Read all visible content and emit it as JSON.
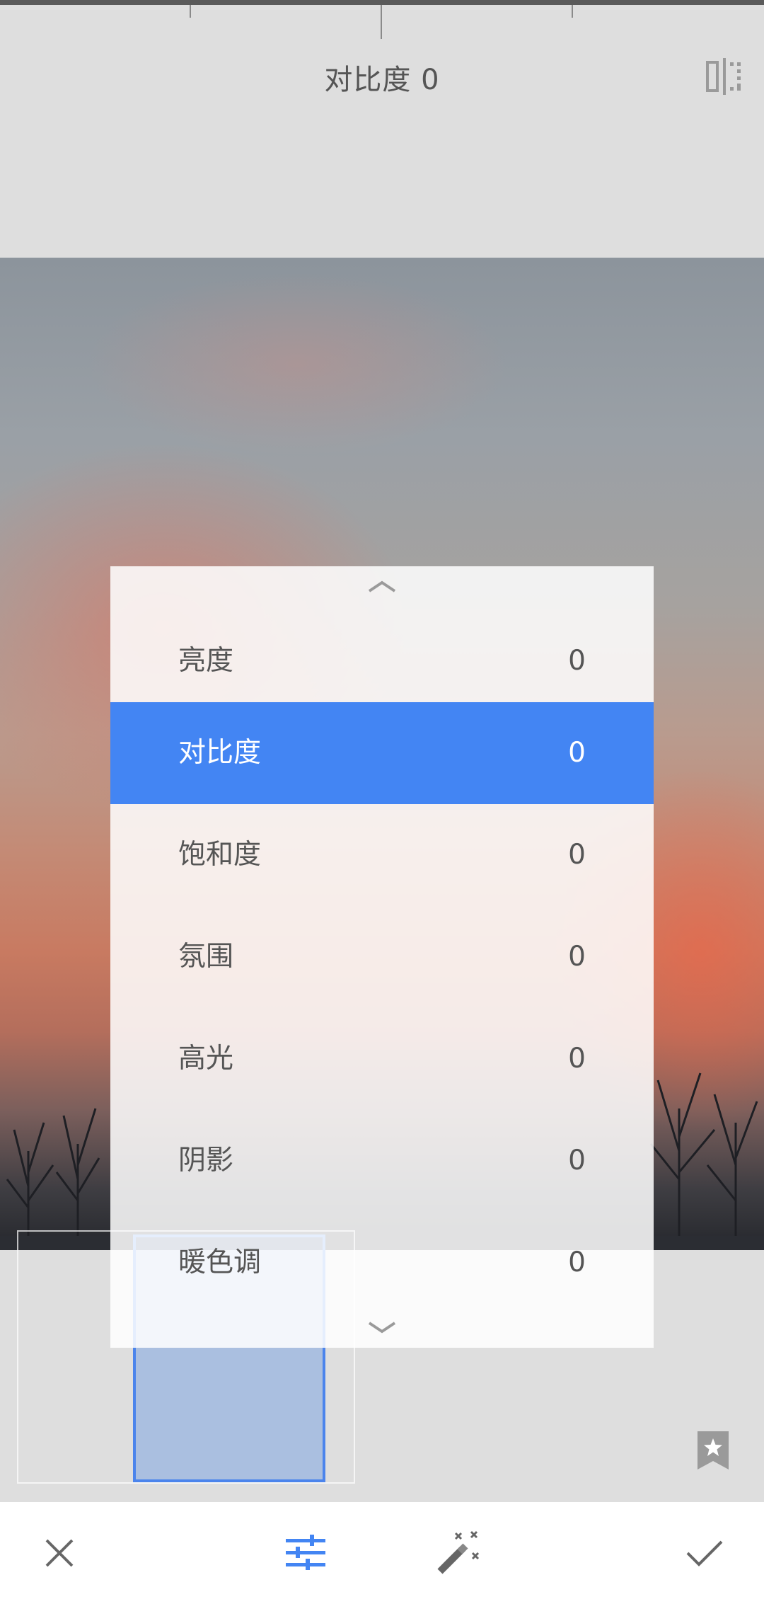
{
  "header": {
    "title": "对比度 0"
  },
  "panel": {
    "items": [
      {
        "label": "亮度",
        "value": "0",
        "active": false
      },
      {
        "label": "对比度",
        "value": "0",
        "active": true
      },
      {
        "label": "饱和度",
        "value": "0",
        "active": false
      },
      {
        "label": "氛围",
        "value": "0",
        "active": false
      },
      {
        "label": "高光",
        "value": "0",
        "active": false
      },
      {
        "label": "阴影",
        "value": "0",
        "active": false
      },
      {
        "label": "暖色调",
        "value": "0",
        "active": false
      }
    ]
  },
  "icons": {
    "compare": "compare-icon",
    "scroll_up": "chevron-up-icon",
    "scroll_down": "chevron-down-icon",
    "bookmark": "star-bookmark-icon",
    "cancel": "close-icon",
    "adjust": "sliders-icon",
    "auto": "magic-wand-icon",
    "apply": "checkmark-icon"
  },
  "colors": {
    "accent": "#4385f3",
    "text": "#555555",
    "background": "#dedede"
  }
}
